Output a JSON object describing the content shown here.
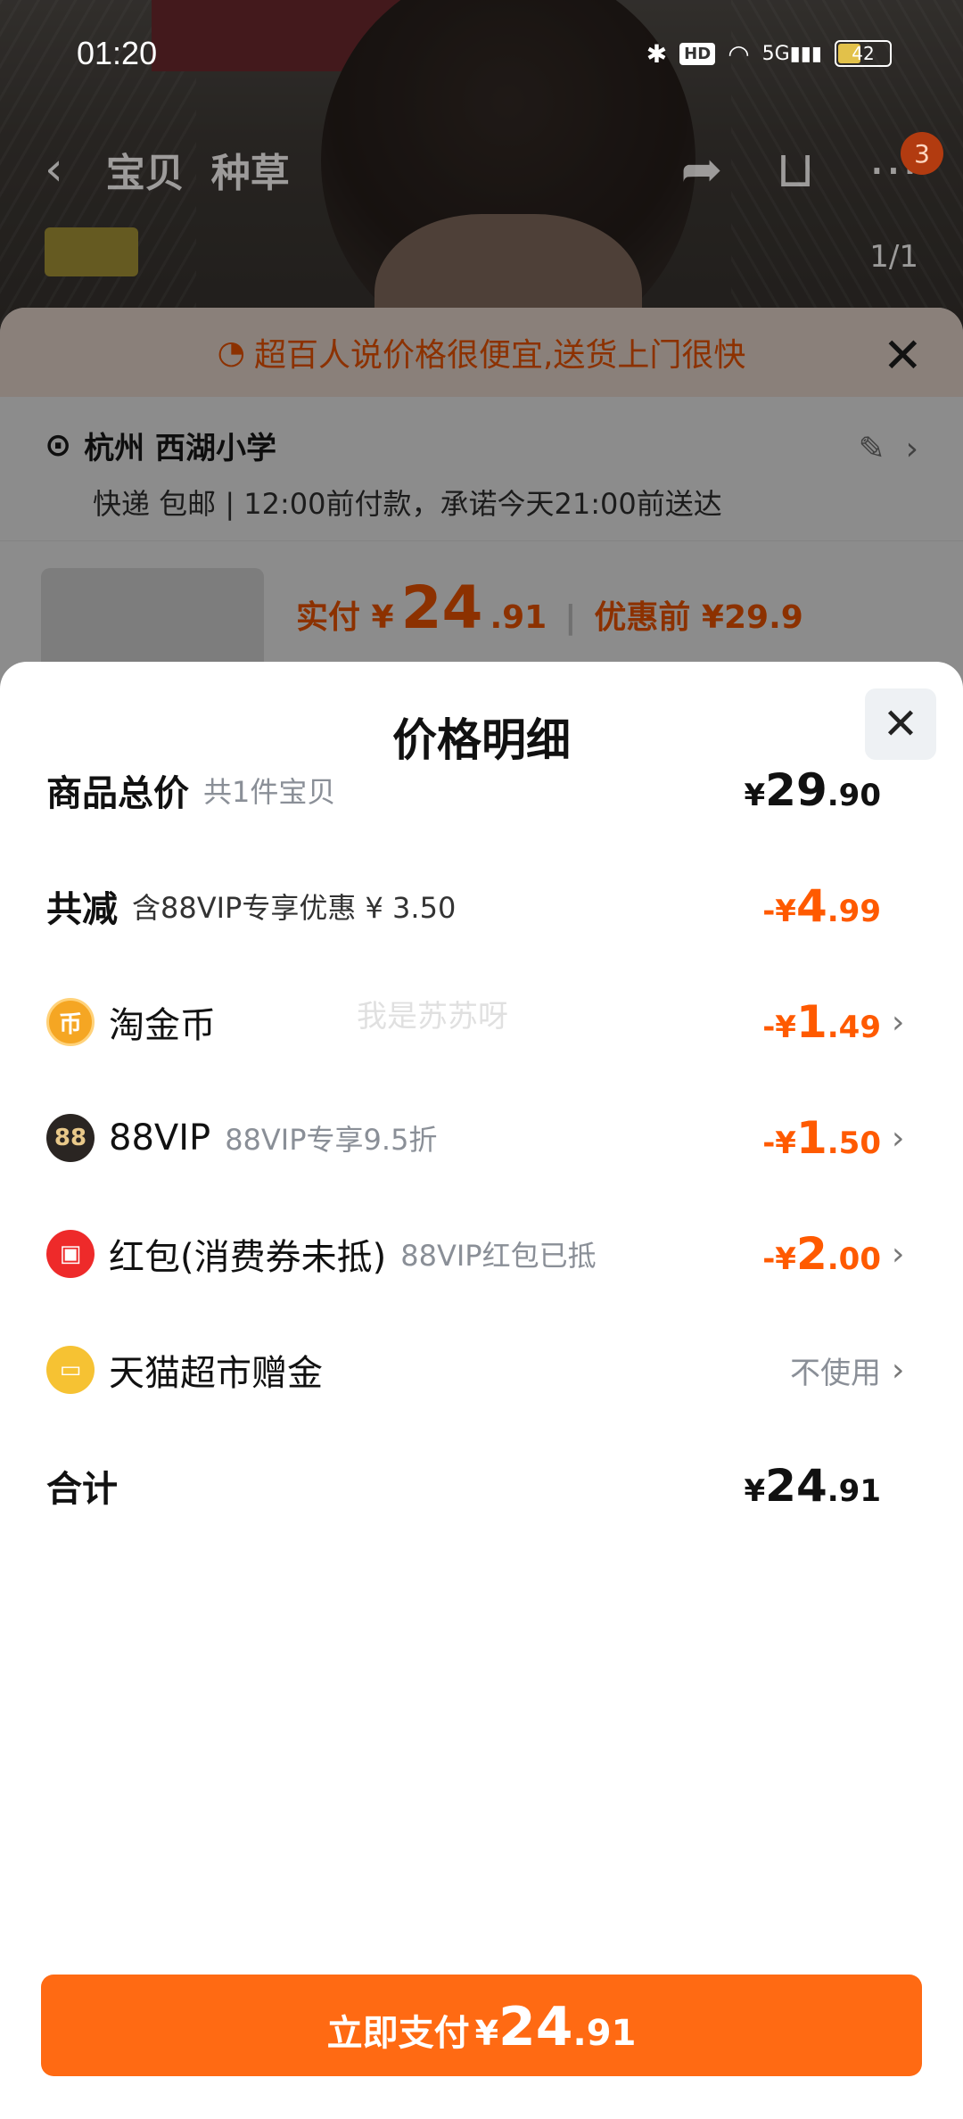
{
  "status_bar": {
    "time": "01:20",
    "battery": "42",
    "network": "5G"
  },
  "nav": {
    "tabs": [
      "宝贝",
      "种草"
    ],
    "cart_badge": "3",
    "image_counter": "1/1"
  },
  "order": {
    "promo": "超百人说价格很便宜,送货上门很快",
    "address": "杭州 西湖小学",
    "delivery": "快递 包邮 | 12:00前付款，承诺今天21:00前送达",
    "paid_label": "实付 ¥",
    "paid_int": "24",
    "paid_dec": ".91",
    "before_label": "优惠前 ¥29.9"
  },
  "sheet": {
    "title": "价格明细",
    "rows": [
      {
        "label": "商品总价",
        "sub": "共1件宝贝",
        "sym": "¥",
        "int": "29",
        "dec": ".90"
      },
      {
        "label": "共减",
        "sub": "含88VIP专享优惠 ¥ 3.50",
        "sym": "-¥",
        "int": "4",
        "dec": ".99"
      },
      {
        "label": "淘金币",
        "sub": "",
        "sym": "-¥",
        "int": "1",
        "dec": ".49"
      },
      {
        "label": "88VIP",
        "sub": "88VIP专享9.5折",
        "sym": "-¥",
        "int": "1",
        "dec": ".50"
      },
      {
        "label": "红包(消费券未抵)",
        "sub": "88VIP红包已抵",
        "sym": "-¥",
        "int": "2",
        "dec": ".00"
      },
      {
        "label": "天猫超市赠金",
        "sub": "",
        "value_text": "不使用"
      },
      {
        "label": "合计",
        "sub": "",
        "sym": "¥",
        "int": "24",
        "dec": ".91"
      }
    ],
    "icons": {
      "coin": "币",
      "vip": "88"
    },
    "watermark": "我是苏苏呀",
    "pay_button": {
      "label": "立即支付",
      "sym": "¥",
      "int": "24",
      "dec": ".91"
    }
  },
  "colors": {
    "accent": "#ff6a13",
    "discount": "#ff5a00"
  }
}
